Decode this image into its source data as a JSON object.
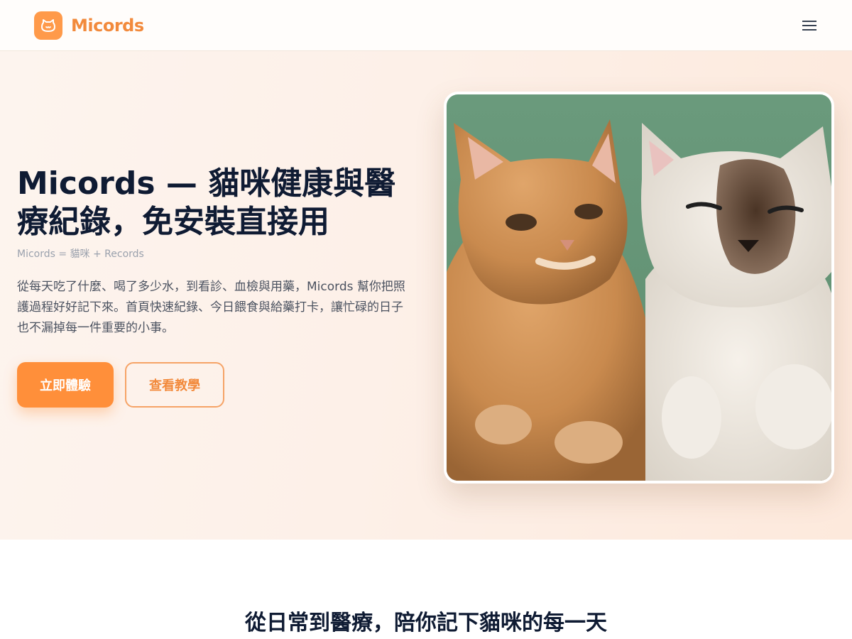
{
  "header": {
    "brand_name": "Micords",
    "logo_icon": "cat-face-icon",
    "menu_icon": "hamburger-menu-icon"
  },
  "hero": {
    "title": "Micords — 貓咪健康與醫療紀錄，免安裝直接用",
    "subtitle": "Micords = 貓咪 + Records",
    "description": "從每天吃了什麼、喝了多少水，到看診、血檢與用藥，Micords 幫你把照護過程好好記下來。首頁快速紀錄、今日餵食與給藥打卡，讓忙碌的日子也不漏掉每一件重要的小事。",
    "primary_button": "立即體驗",
    "secondary_button": "查看教學",
    "image_subject": "two-cats-photo"
  },
  "features": {
    "title": "從日常到醫療，陪你記下貓咪的每一天"
  },
  "colors": {
    "accent": "#ff8f3a",
    "brand_text": "#f28a3c",
    "heading": "#0f1b33",
    "body_text": "#4b5260",
    "muted": "#9aa1ad",
    "hero_bg": "#fdf0e8"
  }
}
